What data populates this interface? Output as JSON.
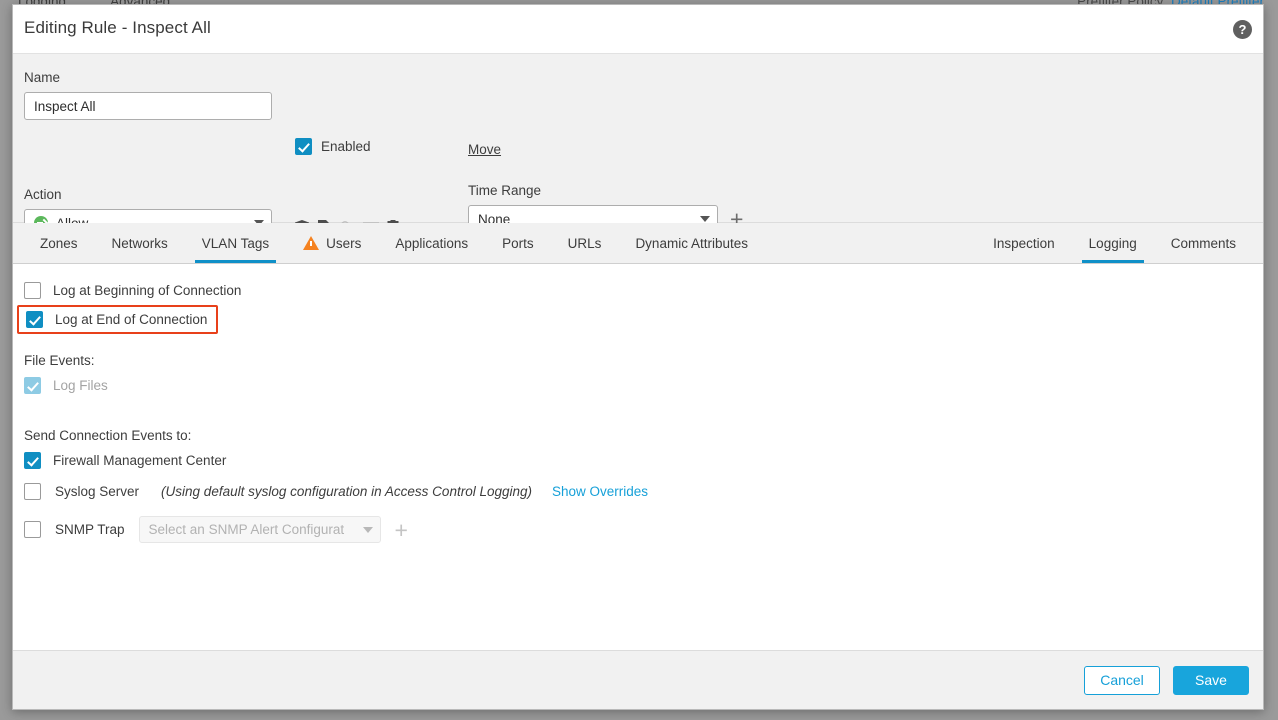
{
  "background": {
    "tabs": [
      "Logging",
      "Advanced"
    ],
    "prefilter_label": "Prefilter Policy:",
    "prefilter_value": "Default Prefilter"
  },
  "dialog": {
    "title": "Editing Rule - Inspect All",
    "help_icon": "help-circle-icon",
    "name_label": "Name",
    "name_value": "Inspect All",
    "name_placeholder": "",
    "enabled_label": "Enabled",
    "enabled_checked": true,
    "move_label": "Move",
    "action_label": "Action",
    "action_value": "Allow",
    "action_icons": [
      "shield-icon",
      "file-policy-icon",
      "safe-search-icon",
      "variable-set-icon",
      "logging-document-icon"
    ],
    "time_range_label": "Time Range",
    "time_range_value": "None",
    "time_range_add": "+"
  },
  "tabs": {
    "left": [
      {
        "label": "Zones",
        "active": false,
        "warning": false
      },
      {
        "label": "Networks",
        "active": false,
        "warning": false
      },
      {
        "label": "VLAN Tags",
        "active": true,
        "warning": false
      },
      {
        "label": "Users",
        "active": false,
        "warning": true
      },
      {
        "label": "Applications",
        "active": false,
        "warning": false
      },
      {
        "label": "Ports",
        "active": false,
        "warning": false
      },
      {
        "label": "URLs",
        "active": false,
        "warning": false
      },
      {
        "label": "Dynamic Attributes",
        "active": false,
        "warning": false
      }
    ],
    "right": [
      {
        "label": "Inspection",
        "active": false
      },
      {
        "label": "Logging",
        "active": true
      },
      {
        "label": "Comments",
        "active": false
      }
    ]
  },
  "logging": {
    "log_begin_label": "Log at Beginning of Connection",
    "log_begin_checked": false,
    "log_end_label": "Log at End of Connection",
    "log_end_checked": true,
    "log_end_highlight_color": "#e8401a",
    "file_events_label": "File Events:",
    "log_files_label": "Log Files",
    "log_files_checked": true,
    "log_files_disabled": true,
    "send_events_label": "Send Connection Events to:",
    "fmc_label": "Firewall Management Center",
    "fmc_checked": true,
    "syslog_label": "Syslog Server",
    "syslog_checked": false,
    "syslog_note": "(Using default syslog configuration in Access Control Logging)",
    "show_overrides_label": "Show Overrides",
    "snmp_label": "SNMP Trap",
    "snmp_checked": false,
    "snmp_placeholder": "Select an SNMP Alert Configurat",
    "snmp_add": "+"
  },
  "footer": {
    "cancel_label": "Cancel",
    "save_label": "Save"
  }
}
